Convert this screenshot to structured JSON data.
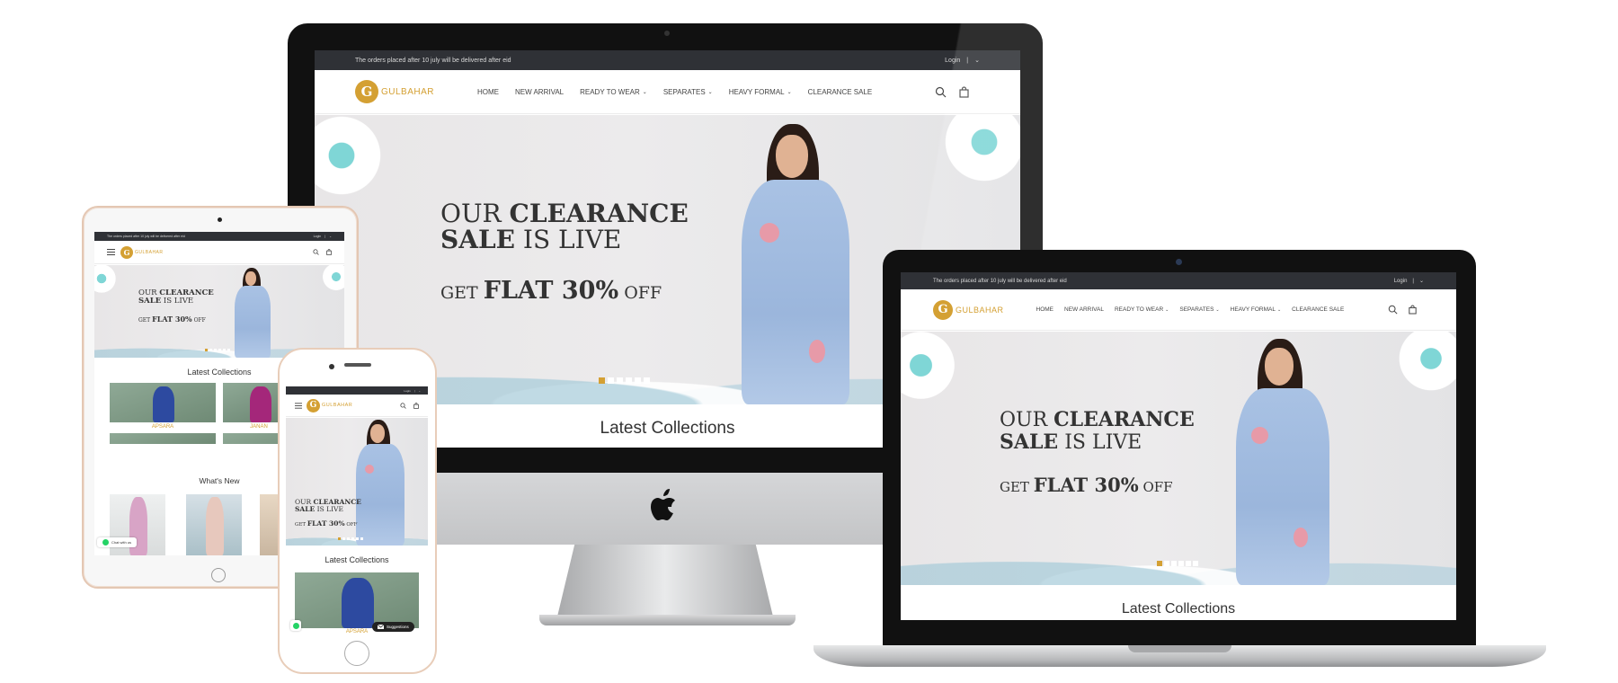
{
  "site": {
    "announcement": "The orders placed after 10 july will be delivered after eid",
    "login": "Login",
    "separator": "|",
    "brand": "GULBAHAR",
    "logo_letter": "G",
    "nav": [
      "HOME",
      "NEW ARRIVAL",
      "READY TO WEAR",
      "SEPARATES",
      "HEAVY FORMAL",
      "CLEARANCE SALE"
    ],
    "caret": "⌄",
    "hero": {
      "line1_light": "OUR",
      "line1_bold": "CLEARANCE",
      "line2_bold": "SALE",
      "line2_light": "IS LIVE",
      "line3_light": "GET",
      "line3_bold": "FLAT 30%",
      "line3_end": "OFF",
      "slides": 6,
      "active_slide": 0
    },
    "latest": "Latest Collections",
    "whats_new": "What's New",
    "collections": [
      "APSARA",
      "JANAN"
    ],
    "chat_label": "Chat with us",
    "suggestions": "Suggestions"
  },
  "colors": {
    "accent": "#d4a033",
    "topbar": "#2f3136"
  },
  "icons": [
    "search-icon",
    "cart-icon",
    "menu-icon",
    "apple-logo-icon",
    "whatsapp-icon",
    "mail-icon"
  ]
}
